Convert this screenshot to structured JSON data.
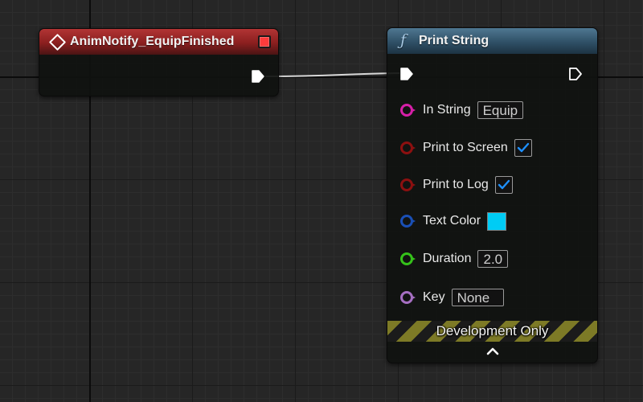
{
  "event_node": {
    "title": "AnimNotify_EquipFinished",
    "header_color": "#8b1f1f"
  },
  "print_node": {
    "title": "Print String",
    "header_color": "#2f5066",
    "pins": {
      "in_string": {
        "label": "In String",
        "value": "Equip",
        "pin_color": "#d61fa8"
      },
      "print_to_screen": {
        "label": "Print to Screen",
        "checked": true,
        "pin_color": "#8c1010"
      },
      "print_to_log": {
        "label": "Print to Log",
        "checked": true,
        "pin_color": "#8c1010"
      },
      "text_color": {
        "label": "Text Color",
        "swatch": "#00ccf5",
        "pin_color": "#1a4fb5"
      },
      "duration": {
        "label": "Duration",
        "value": "2.0",
        "pin_color": "#35c21a"
      },
      "key": {
        "label": "Key",
        "value": "None",
        "pin_color": "#a66fc2"
      }
    },
    "banner": "Development Only"
  },
  "icons": {
    "event": "diamond-icon",
    "delegate": "delegate-pin-icon",
    "function": "function-icon",
    "exec": "exec-pin-icon",
    "collapse": "chevron-up-icon",
    "check": "checkmark-icon"
  },
  "colors": {
    "grid_background": "#262626",
    "check_mark": "#1e90ff",
    "wire": "#d8d8d8"
  }
}
